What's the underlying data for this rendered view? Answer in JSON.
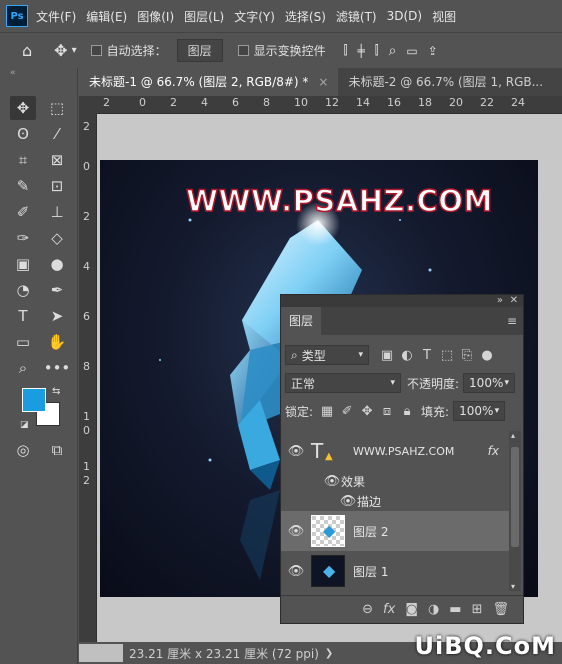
{
  "app": {
    "logo": "Ps"
  },
  "menubar": {
    "items": [
      "文件(F)",
      "编辑(E)",
      "图像(I)",
      "图层(L)",
      "文字(Y)",
      "选择(S)",
      "滤镜(T)",
      "3D(D)",
      "视图"
    ]
  },
  "options": {
    "auto_select_label": "自动选择：",
    "auto_select_value": "图层",
    "show_transform_label": "显示变换控件"
  },
  "tabs": [
    {
      "label": "未标题-1 @ 66.7% (图层 2, RGB/8#) *",
      "close": "×"
    },
    {
      "label": "未标题-2 @ 66.7% (图层 1, RGB...",
      "close": ""
    }
  ],
  "ruler": {
    "top": [
      "2",
      "0",
      "2",
      "4",
      "6",
      "8",
      "10",
      "12",
      "14",
      "16",
      "18",
      "20",
      "22",
      "24"
    ],
    "left": [
      "2",
      "0",
      "2",
      "4",
      "6",
      "8",
      "1",
      "0",
      "1",
      "2"
    ]
  },
  "canvas": {
    "watermark_text": "WWW.PSAHZ.COM"
  },
  "status": {
    "text": "23.21 厘米 x 23.21 厘米 (72 ppi)",
    "arrow": "❯"
  },
  "layers_panel": {
    "tab": "图层",
    "filter_kind": "类型",
    "blend_mode": "正常",
    "opacity_label": "不透明度:",
    "opacity_value": "100%",
    "lock_label": "锁定:",
    "fill_label": "填充:",
    "fill_value": "100%",
    "layers": [
      {
        "name": "WWW.PSAHZ.COM",
        "type": "text",
        "fx": "fx",
        "selected": false
      },
      {
        "name": "效果",
        "type": "effects-header"
      },
      {
        "name": "描边",
        "type": "effect"
      },
      {
        "name": "图层 2",
        "type": "pixel",
        "selected": true
      },
      {
        "name": "图层 1",
        "type": "pixel",
        "selected": false
      }
    ]
  },
  "colors": {
    "foreground": "#1a9de0",
    "background": "#ffffff",
    "selected_row": "#6b6b6b",
    "watermark_stroke": "#b3172a"
  },
  "site_watermark": "UiBQ.CoM"
}
